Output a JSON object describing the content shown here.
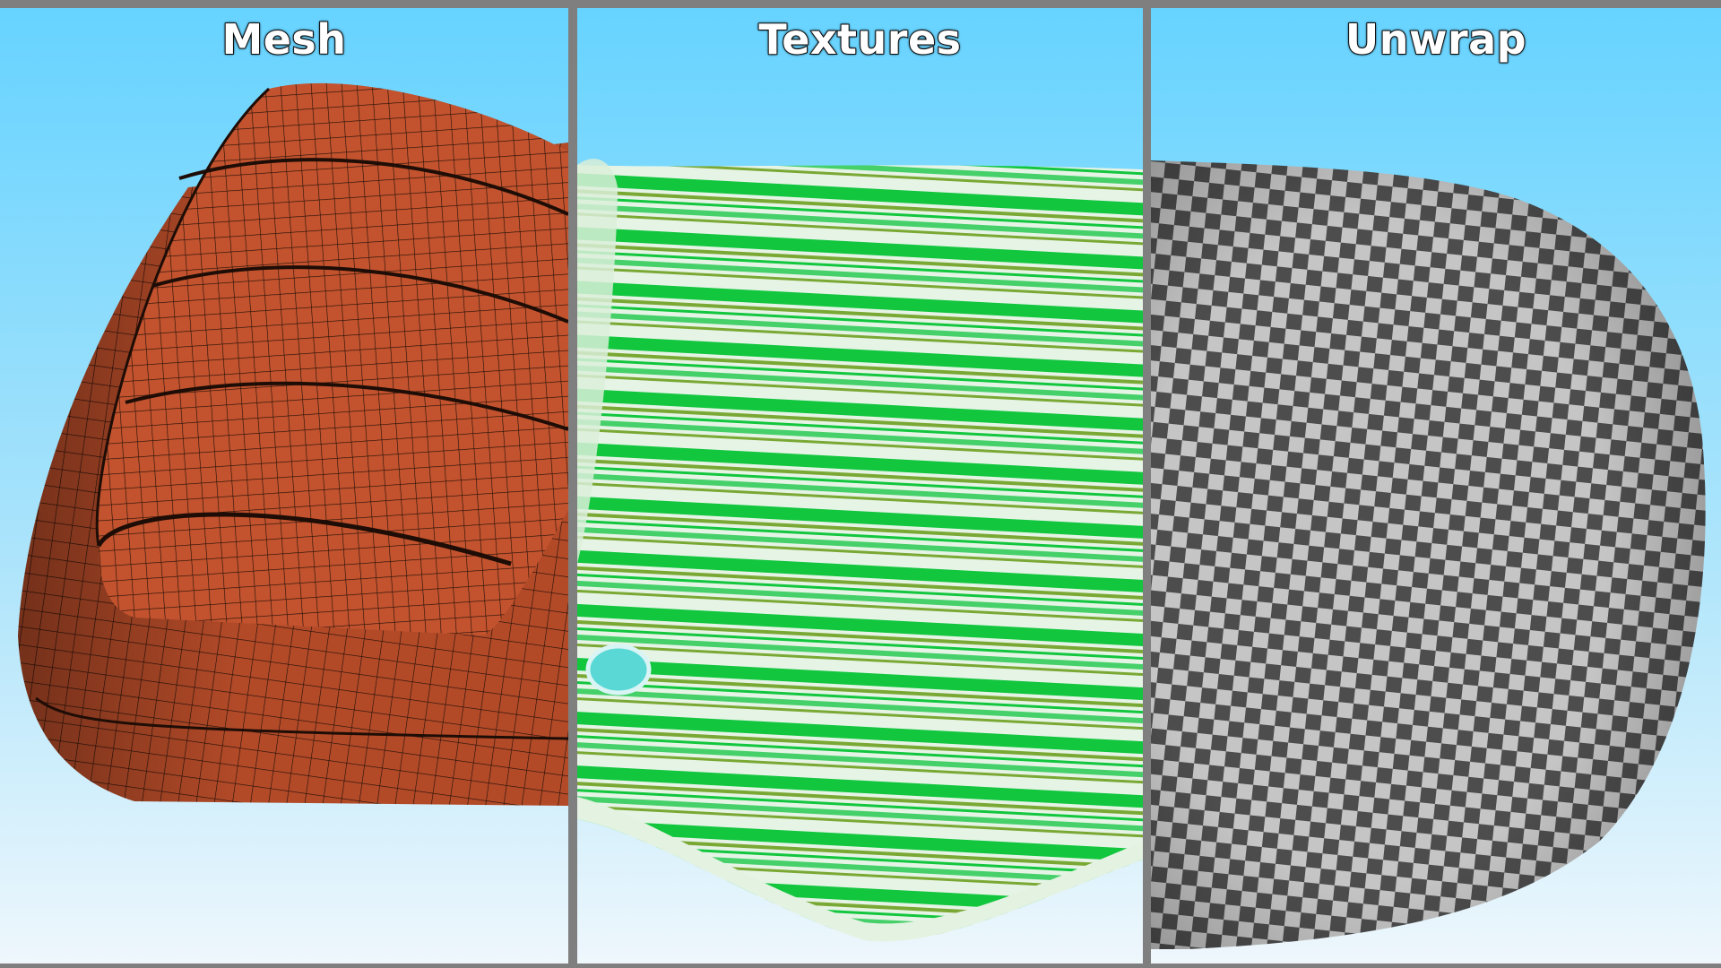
{
  "panels": [
    {
      "title": "Mesh",
      "icon": "wireframe-mesh-render"
    },
    {
      "title": "Textures",
      "icon": "green-striped-texture-render"
    },
    {
      "title": "Unwrap",
      "icon": "checker-uv-render"
    }
  ],
  "colors": {
    "sky_top": "#66d3ff",
    "sky_bottom": "#eef7fc",
    "mesh_surface": "#c2532e",
    "wire": "#1e0d06",
    "stripe_green": "#12c63e",
    "stripe_olive": "#7aa834",
    "texture_base": "#e6f4e6",
    "checker_dark": "#4d4d4d",
    "checker_light": "#c5c5c5",
    "divider": "#7f7f7f"
  }
}
